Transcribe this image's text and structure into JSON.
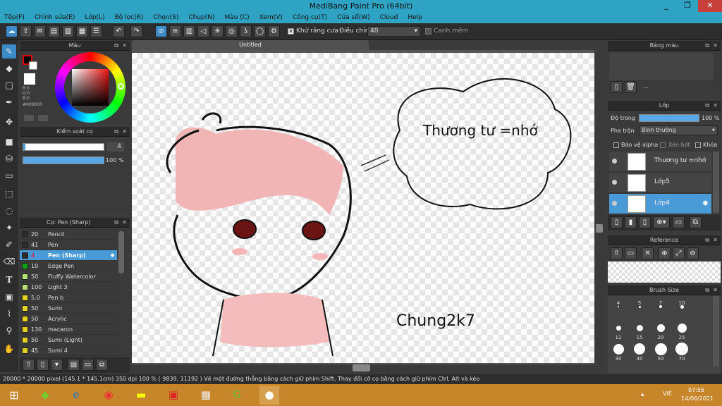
{
  "window": {
    "title": "MediBang Paint Pro (64bit)",
    "minimize": "_",
    "restore": "❐",
    "close": "✕"
  },
  "menu": [
    "Tệp(F)",
    "Chỉnh sửa(E)",
    "Lớp(L)",
    "Bộ lọc(R)",
    "Chọn(S)",
    "Chụp(N)",
    "Màu (C)",
    "Xem(V)",
    "Công cụ(T)",
    "Cửa sổ(W)",
    "Cloud",
    "Help"
  ],
  "toolbar": {
    "antialias_label": "Khử răng cưa",
    "adjust_label": "Điều chỉnh",
    "adjust_value": "40",
    "smooth_label": "Canh mềm"
  },
  "color_panel": {
    "title": "Màu",
    "rgb": "R:0\nG:0\nB:0",
    "hex": "#000000"
  },
  "brush_control": {
    "title": "Kiểm soát cọ",
    "size": "4",
    "opacity": "100 %"
  },
  "brush_panel": {
    "title": "Cọ: Pen (Sharp)",
    "brushes": [
      {
        "size": "20",
        "name": "Pencil",
        "color": "#2a2a2a"
      },
      {
        "size": "41",
        "name": "Pen",
        "color": "#2a2a2a"
      },
      {
        "size": "4",
        "name": "Pen (Sharp)",
        "color": "#2a2a2a",
        "selected": true
      },
      {
        "size": "10",
        "name": "Edge Pen",
        "color": "#12a112"
      },
      {
        "size": "50",
        "name": "Fluffy Watercolor",
        "color": "#b6e07a"
      },
      {
        "size": "100",
        "name": "Light 3",
        "color": "#b6e07a"
      },
      {
        "size": "5.0",
        "name": "Pen b",
        "color": "#e6d21a"
      },
      {
        "size": "50",
        "name": "Sumi",
        "color": "#e6d21a"
      },
      {
        "size": "50",
        "name": "Acrylic",
        "color": "#e6d21a"
      },
      {
        "size": "130",
        "name": "macaron",
        "color": "#e6d21a"
      },
      {
        "size": "50",
        "name": "Sumi (Light)",
        "color": "#e6d21a"
      },
      {
        "size": "45",
        "name": "Sumi 4",
        "color": "#e6d21a"
      }
    ]
  },
  "document": {
    "tab": "Untitled",
    "speech_text": "Thương tư =nhớ",
    "signature": "Chung2k7"
  },
  "palette_panel": {
    "title": "Bảng màu",
    "dash": "---"
  },
  "layer_panel": {
    "title": "Lớp",
    "opacity_label": "Độ trong",
    "opacity_value": "100 %",
    "blend_label": "Pha trộn",
    "blend_value": "Bình thường",
    "protect_alpha": "Bảo vệ alpha",
    "clipping": "Xén bớt",
    "lock": "Khóa",
    "layers": [
      {
        "name": "Thương tư =nhớ",
        "selected": false
      },
      {
        "name": "Lớp5",
        "selected": false
      },
      {
        "name": "Lớp4",
        "selected": true
      }
    ]
  },
  "reference_panel": {
    "title": "Reference"
  },
  "brush_size_panel": {
    "title": "Brush Size",
    "sizes": [
      "4",
      "5",
      "7",
      "10",
      "12",
      "15",
      "20",
      "25",
      "30",
      "40",
      "50",
      "70"
    ]
  },
  "status": "20000 * 20000 pixel  (145.1 * 145.1cm)  350 dpi  100 %  ( 9839, 11192 )  Vẽ một đường thẳng bằng cách giữ phím Shift, Thay đổi cỡ cọ bằng cách giữ phím Ctrl, Alt và kéo",
  "taskbar": {
    "lang": "VIE",
    "time": "07:56",
    "date": "14/06/2021"
  }
}
